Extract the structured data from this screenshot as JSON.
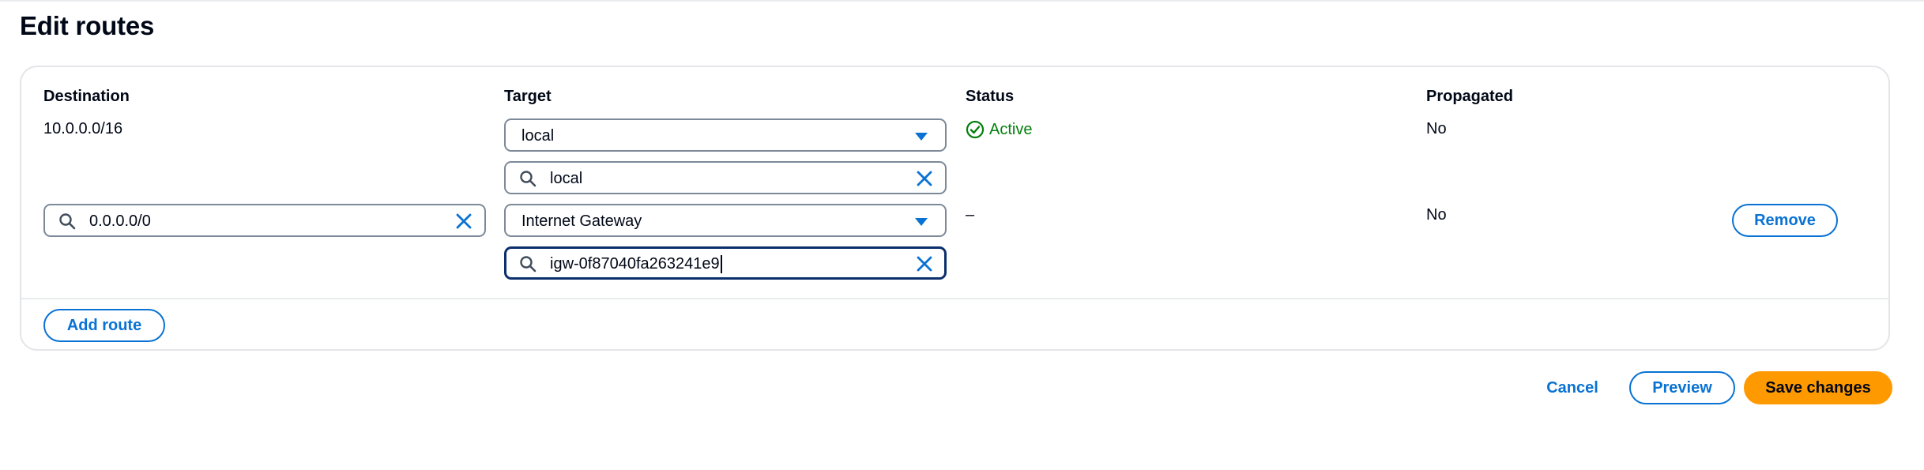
{
  "page": {
    "title": "Edit routes"
  },
  "table": {
    "headers": {
      "destination": "Destination",
      "target": "Target",
      "status": "Status",
      "propagated": "Propagated"
    },
    "rows": [
      {
        "destination": "10.0.0.0/16",
        "target_type": "local",
        "target_search": "local",
        "status": "Active",
        "propagated": "No"
      },
      {
        "destination_input": "0.0.0.0/0",
        "target_type": "Internet Gateway",
        "target_search": "igw-0f87040fa263241e9",
        "status": "–",
        "propagated": "No",
        "remove_label": "Remove"
      }
    ]
  },
  "actions": {
    "add_route": "Add route",
    "cancel": "Cancel",
    "preview": "Preview",
    "save": "Save changes"
  },
  "colors": {
    "accent": "#0972d3",
    "primary_button": "#ff9900",
    "success": "#037f0c",
    "input_border": "#7d8998",
    "focused_border": "#0a2f6b"
  },
  "icons": {
    "search": "search-icon",
    "clear": "close-icon",
    "caret": "caret-down-icon",
    "status": "check-circle-icon"
  }
}
